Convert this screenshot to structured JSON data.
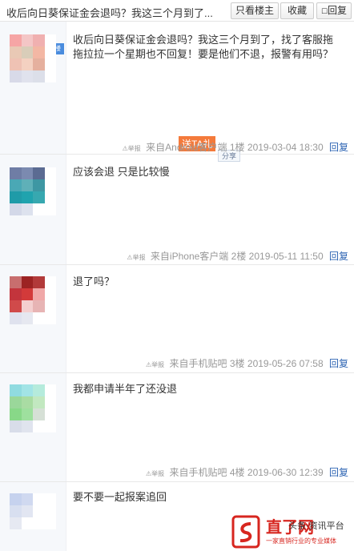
{
  "header": {
    "title": "收后向日葵保证金会退吗？我这三个月到了...",
    "btn_louzhu": "只看楼主",
    "btn_shoucang": "收藏",
    "btn_huifu": "回复"
  },
  "posts": [
    {
      "content": "收后向日葵保证金会退吗？我这三个月到了，找了客服拖拖拉拉一个星期也不回复！要是他们不退，报警有用吗？",
      "source": "来自Android客户端",
      "floor": "1楼",
      "time": "2019-03-04 18:30",
      "reply": "回复",
      "report": "⚠举报",
      "avatar": [
        "#f6a5a5",
        "#f4c6c6",
        "#f0b0b0",
        "#ffffff",
        "#e9c9b5",
        "#d9cdb9",
        "#f3b7a4",
        "#ffffff",
        "#efc2b4",
        "#f4d1c1",
        "#e5b09e",
        "#ffffff",
        "#d8dae8",
        "#e0e2ed",
        "#dcdfe9",
        "#ffffff"
      ]
    },
    {
      "content": "应该会退 只是比较慢",
      "source": "来自iPhone客户端",
      "floor": "2楼",
      "time": "2019-05-11 11:50",
      "reply": "回复",
      "report": "⚠举报",
      "avatar": [
        "#6f7da5",
        "#7b8ab0",
        "#5b6b92",
        "#ffffff",
        "#4aa8b5",
        "#5fb0b8",
        "#3e97a3",
        "#ffffff",
        "#1f9ba8",
        "#20a3ae",
        "#37a8b0",
        "#ffffff",
        "#d3d8e8",
        "#dde2ee",
        "#ffffff",
        "#ffffff"
      ]
    },
    {
      "content": "退了吗？",
      "source": "来自手机贴吧",
      "floor": "3楼",
      "time": "2019-05-26 07:58",
      "reply": "回复",
      "report": "⚠举报",
      "avatar": [
        "#c86e6e",
        "#9c2323",
        "#b23a3a",
        "#ffffff",
        "#c3343c",
        "#d33a3a",
        "#f0a8a8",
        "#ffffff",
        "#d04a4a",
        "#f4cfcf",
        "#e7b4b4",
        "#ffffff",
        "#dfe2ee",
        "#e6e8f0",
        "#ffffff",
        "#ffffff"
      ]
    },
    {
      "content": "我都申请半年了还没退",
      "source": "来自手机贴吧",
      "floor": "4楼",
      "time": "2019-06-30 12:39",
      "reply": "回复",
      "report": "⚠举报",
      "avatar": [
        "#90dbe0",
        "#a2e4e6",
        "#b5ebdc",
        "#ffffff",
        "#9ad79a",
        "#a9dca3",
        "#c2e8c0",
        "#ffffff",
        "#88d888",
        "#9ee09e",
        "#d6e0d6",
        "#ffffff",
        "#d8dde9",
        "#e0e4ee",
        "#ffffff",
        "#ffffff"
      ]
    },
    {
      "content": "要不要一起报案追回",
      "avatar": [
        "#c6d2ee",
        "#d0d9f0",
        "#ffffff",
        "#ffffff",
        "#d8dff0",
        "#e2e6f2",
        "#ffffff",
        "#ffffff",
        "#e6e9f2",
        "#ffffff",
        "#ffffff",
        "#ffffff"
      ]
    }
  ],
  "gift": "送TA礼",
  "share": "分享",
  "watermark": {
    "logo": "直了网",
    "sub": "一家直销行业的专业媒体",
    "overlay": "头条·资讯平台"
  }
}
